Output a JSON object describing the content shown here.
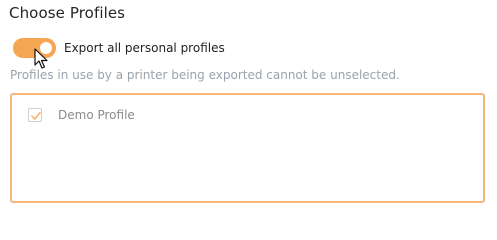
{
  "section": {
    "title": "Choose Profiles"
  },
  "export_toggle": {
    "label": "Export all personal profiles",
    "state": "on"
  },
  "hint": {
    "text": "Profiles in use by a printer being exported cannot be unselected."
  },
  "profiles": [
    {
      "label": "Demo Profile",
      "checked": true,
      "disabled": true
    }
  ],
  "colors": {
    "accent": "#f5a653",
    "box_border": "#f5b877",
    "hint_text": "#9aa3ad",
    "disabled_text": "#8b8b8b"
  }
}
